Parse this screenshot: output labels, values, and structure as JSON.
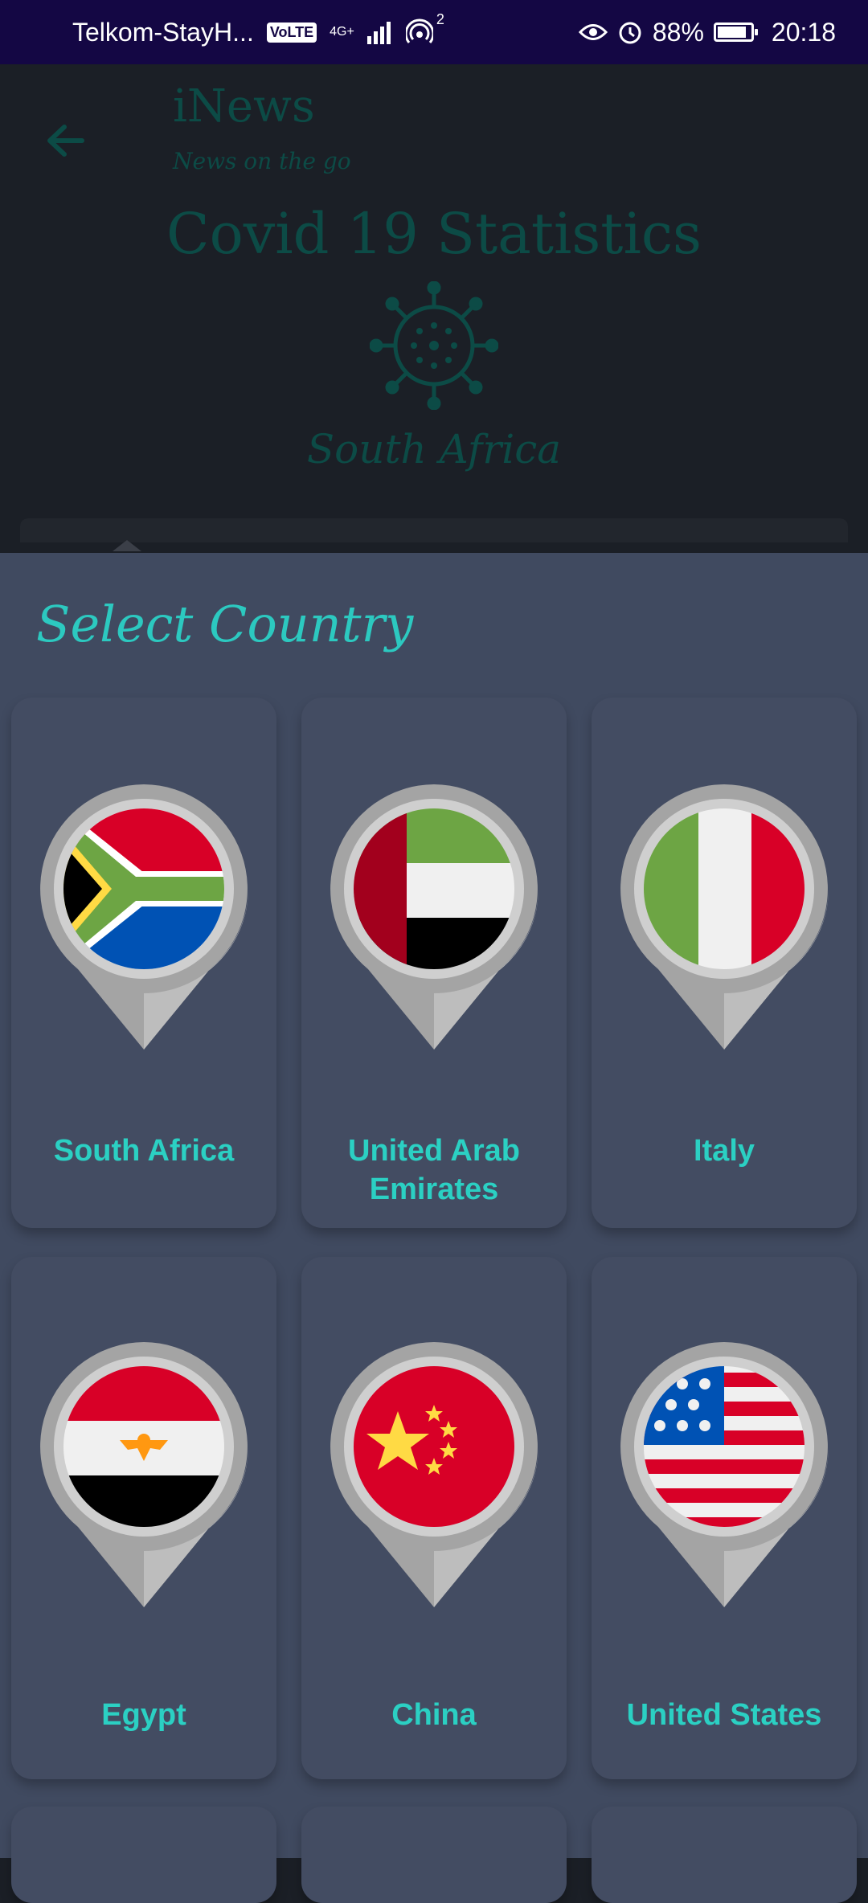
{
  "status_bar": {
    "carrier": "Telkom-StayH...",
    "volte": "VoLTE",
    "network": "4G+",
    "hotspot_count": "2",
    "battery": "88%",
    "battery_level": 0.88,
    "time": "20:18",
    "icons": [
      "eye-icon",
      "alarm-icon",
      "signal-icon",
      "hotspot-icon",
      "battery-icon"
    ]
  },
  "header": {
    "app_name": "iNews",
    "tagline": "News on the go",
    "title": "Covid 19 Statistics",
    "selected_country": "South Africa"
  },
  "sheet": {
    "title": "Select Country",
    "countries": [
      {
        "name": "South Africa",
        "flag": "south-africa-flag-icon"
      },
      {
        "name": "United Arab Emirates",
        "flag": "uae-flag-icon"
      },
      {
        "name": "Italy",
        "flag": "italy-flag-icon"
      },
      {
        "name": "Egypt",
        "flag": "egypt-flag-icon"
      },
      {
        "name": "China",
        "flag": "china-flag-icon"
      },
      {
        "name": "United States",
        "flag": "usa-flag-icon"
      }
    ]
  },
  "colors": {
    "status_bar": "#140744",
    "accent": "#2cc9c0",
    "sheet_bg": "#404a60",
    "dim_header_text": "#0c4b46"
  }
}
